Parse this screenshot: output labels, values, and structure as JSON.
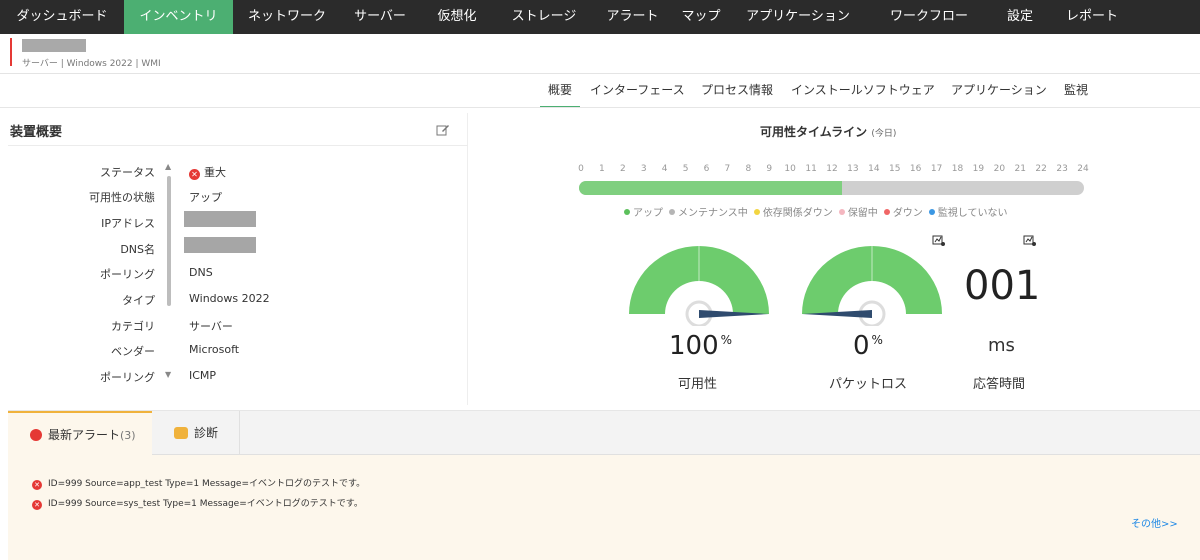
{
  "nav": {
    "tabs": [
      "ダッシュボード",
      "インベントリ",
      "ネットワーク",
      "サーバー",
      "仮想化",
      "ストレージ",
      "アラート",
      "マップ",
      "アプリケーション",
      "ワークフロー",
      "設定",
      "レポート"
    ],
    "active": "インベントリ"
  },
  "device": {
    "subtitle": "サーバー | Windows 2022 | WMI"
  },
  "subtabs": [
    "概要",
    "インターフェース",
    "プロセス情報",
    "インストールソフトウェア",
    "アプリケーション",
    "監視"
  ],
  "overview": {
    "title": "装置概要",
    "props": [
      {
        "key": "ステータス",
        "value": "重大",
        "icon": "critical-x-icon"
      },
      {
        "key": "可用性の状態",
        "value": "アップ"
      },
      {
        "key": "IPアドレス",
        "value": ""
      },
      {
        "key": "DNS名",
        "value": ""
      },
      {
        "key": "ポーリング",
        "value": "DNS"
      },
      {
        "key": "タイプ",
        "value": "Windows 2022"
      },
      {
        "key": "カテゴリ",
        "value": "サーバー"
      },
      {
        "key": "ベンダー",
        "value": "Microsoft"
      },
      {
        "key": "ポーリング",
        "value": "ICMP"
      }
    ]
  },
  "timeline": {
    "title": "可用性タイムライン",
    "subtitle": "(今日)",
    "hours": [
      "0",
      "1",
      "2",
      "3",
      "4",
      "5",
      "6",
      "7",
      "8",
      "9",
      "10",
      "11",
      "12",
      "13",
      "14",
      "15",
      "16",
      "17",
      "18",
      "19",
      "20",
      "21",
      "22",
      "23",
      "24"
    ],
    "up_until_hour": 12.5,
    "legend": [
      {
        "label": "アップ",
        "color": "#5cc05c"
      },
      {
        "label": "メンテナンス中",
        "color": "#b5b5b5"
      },
      {
        "label": "依存関係ダウン",
        "color": "#f2d541"
      },
      {
        "label": "保留中",
        "color": "#f4b7c0"
      },
      {
        "label": "ダウン",
        "color": "#f06666"
      },
      {
        "label": "監視していない",
        "color": "#3b97e3"
      }
    ]
  },
  "gauges": {
    "availability": {
      "value": "100",
      "unit": "%",
      "label": "可用性",
      "percent": 100
    },
    "packet_loss": {
      "value": "0",
      "unit": "%",
      "label": "パケットロス",
      "percent": 0
    },
    "response": {
      "value": "001",
      "unit": "ms",
      "label": "応答時間"
    }
  },
  "bottom": {
    "tabs": {
      "alerts": "最新アラート",
      "alerts_count": "(3)",
      "diagnosis": "診断"
    },
    "alerts": [
      "ID=999 Source=app_test Type=1 Message=イベントログのテストです。",
      "ID=999 Source=sys_test Type=1 Message=イベントログのテストです。"
    ],
    "more": "その他>>"
  },
  "colors": {
    "accent": "#4caf72",
    "gauge_green": "#6dcc6d",
    "gauge_needle": "#2f4b6e",
    "critical": "#e53935",
    "link": "#1e88e5"
  }
}
